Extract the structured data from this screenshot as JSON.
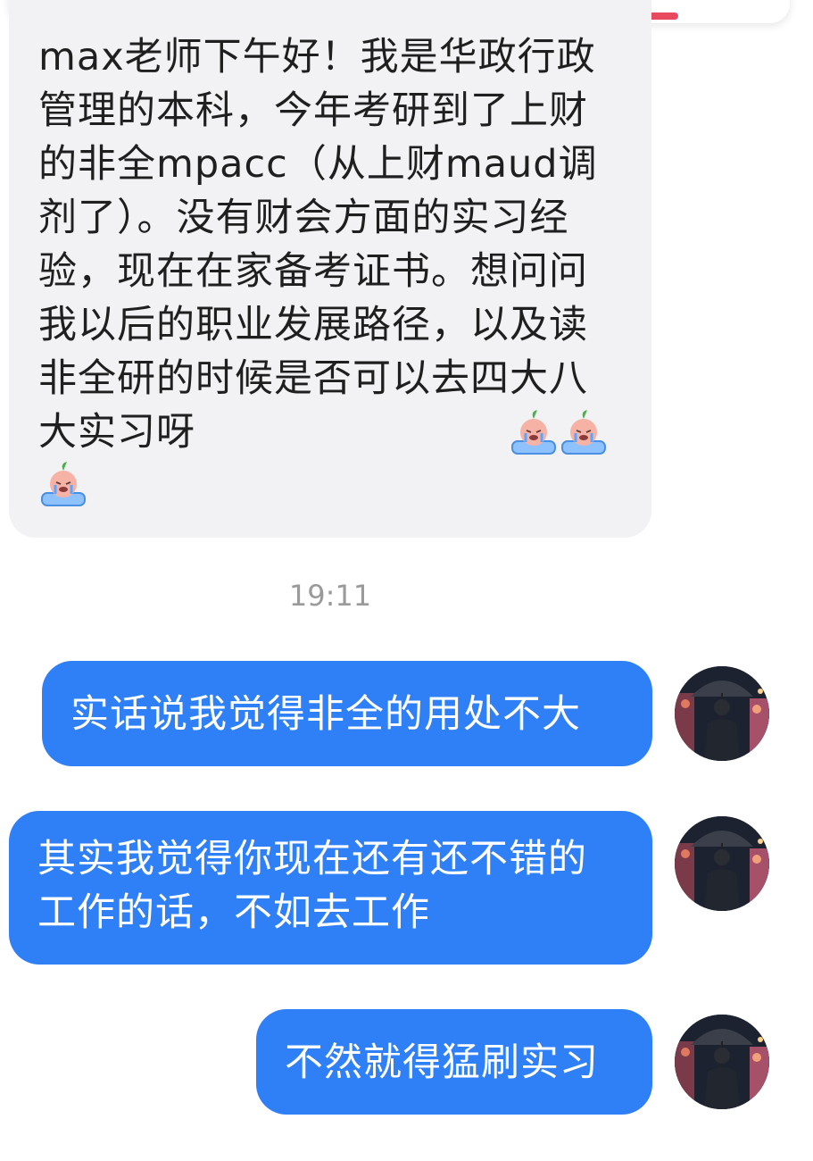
{
  "incoming_message": {
    "text": "max老师下午好！我是华政行政管理的本科，今年考研到了上财的非全mpacc（从上财maud调剂了）。没有财会方面的实习经验，现在在家备考证书。想问问我以后的职业发展路径，以及读非全研的时候是否可以去四大八大实习呀",
    "emojis": [
      "crying-face-emoji",
      "crying-face-emoji",
      "crying-face-emoji"
    ]
  },
  "timestamp": "19:11",
  "outgoing_messages": [
    {
      "text": "实话说我觉得非全的用处不大",
      "avatar": "man-with-umbrella-avatar"
    },
    {
      "text": "其实我觉得你现在还有还不错的工作的话，不如去工作",
      "avatar": "man-with-umbrella-avatar"
    },
    {
      "text": "不然就得猛刷实习",
      "avatar": "man-with-umbrella-avatar"
    }
  ],
  "colors": {
    "outgoing_bubble": "#2f80f7",
    "incoming_bubble": "#f2f2f4",
    "timestamp": "#9a9a9a"
  }
}
